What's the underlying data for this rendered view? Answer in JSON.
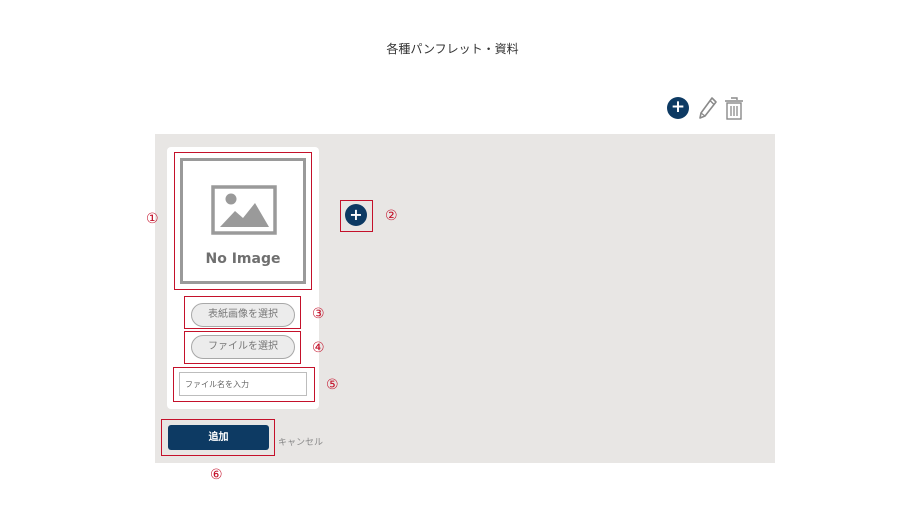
{
  "page": {
    "title": "各種パンフレット・資料"
  },
  "toolbar": {
    "add_icon": "plus-circle-icon",
    "add_symbol": "+",
    "edit_icon": "pencil-icon",
    "delete_icon": "trash-icon"
  },
  "card": {
    "placeholder_text": "No Image",
    "select_cover_label": "表紙画像を選択",
    "select_file_label": "ファイルを選択",
    "filename_placeholder": "ファイル名を入力",
    "add_more_symbol": "+"
  },
  "actions": {
    "submit_label": "追加",
    "cancel_label": "キャンセル"
  },
  "annotations": {
    "n1": "①",
    "n2": "②",
    "n3": "③",
    "n4": "④",
    "n5": "⑤",
    "n6": "⑥"
  },
  "colors": {
    "brand_navy": "#0d3a63",
    "annotation_red": "#c4112a",
    "panel_bg": "#e8e6e4"
  }
}
